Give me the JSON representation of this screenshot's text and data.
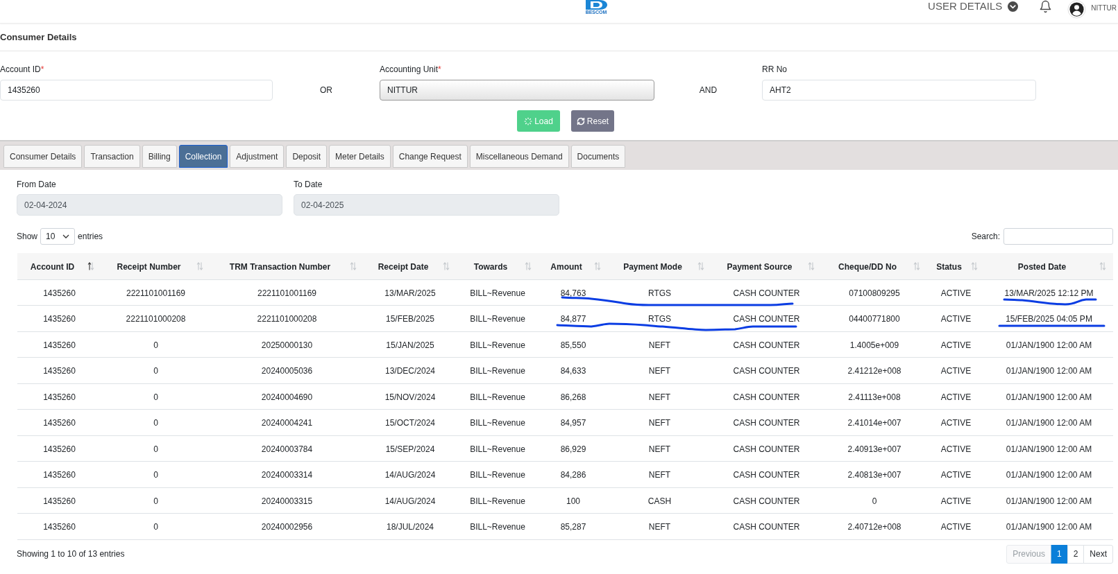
{
  "header": {
    "logo_text": "BESCOM",
    "user_menu": "USER DETAILS",
    "user_name": "NITTUR"
  },
  "section_title": "Consumer Details",
  "search_form": {
    "fields": [
      {
        "label": "Account ID",
        "required_mark": "*",
        "kind": "input",
        "value": "1435260"
      },
      {
        "label": "Accounting Unit",
        "required_mark": "*",
        "kind": "select",
        "value": "NITTUR"
      },
      {
        "label": "RR No",
        "kind": "input",
        "value": "AHT2"
      }
    ],
    "connectors": [
      "OR",
      "AND"
    ]
  },
  "buttons": [
    {
      "label": "Load",
      "kind": "load"
    },
    {
      "label": "Reset",
      "kind": "reset"
    }
  ],
  "tabs": [
    {
      "label": "Consumer Details",
      "selected": false
    },
    {
      "label": "Transaction",
      "selected": false
    },
    {
      "label": "Billing",
      "selected": false
    },
    {
      "label": "Collection",
      "selected": true
    },
    {
      "label": "Adjustment",
      "selected": false
    },
    {
      "label": "Deposit",
      "selected": false
    },
    {
      "label": "Meter Details",
      "selected": false
    },
    {
      "label": "Change Request",
      "selected": false
    },
    {
      "label": "Miscellaneous Demand",
      "selected": false
    },
    {
      "label": "Documents",
      "selected": false
    }
  ],
  "date_filters": [
    {
      "label": "From Date",
      "value": "02-04-2024",
      "disabled": true
    },
    {
      "label": "To Date",
      "value": "02-04-2025",
      "disabled": true
    }
  ],
  "table_controls": {
    "show_label": "Show",
    "page_size": "10",
    "entries_label": "entries",
    "search_label": "Search:"
  },
  "table": {
    "columns": [
      {
        "label": "Account ID",
        "sorted": true
      },
      {
        "label": "Receipt Number",
        "sorted": false
      },
      {
        "label": "TRM Transaction Number",
        "sorted": false
      },
      {
        "label": "Receipt Date",
        "sorted": false
      },
      {
        "label": "Towards",
        "sorted": false
      },
      {
        "label": "Amount",
        "sorted": false
      },
      {
        "label": "Payment Mode",
        "sorted": false
      },
      {
        "label": "Payment Source",
        "sorted": false
      },
      {
        "label": "Cheque/DD No",
        "sorted": false
      },
      {
        "label": "Status",
        "sorted": false
      },
      {
        "label": "Posted Date",
        "sorted": false
      }
    ],
    "rows": [
      [
        "1435260",
        "2221101001169",
        "2221101001169",
        "13/MAR/2025",
        "BILL~Revenue",
        "84,763",
        "RTGS",
        "CASH COUNTER",
        "07100809295",
        "ACTIVE",
        "13/MAR/2025 12:12 PM"
      ],
      [
        "1435260",
        "2221101000208",
        "2221101000208",
        "15/FEB/2025",
        "BILL~Revenue",
        "84,877",
        "RTGS",
        "CASH COUNTER",
        "04400771800",
        "ACTIVE",
        "15/FEB/2025 04:05 PM"
      ],
      [
        "1435260",
        "0",
        "20250000130",
        "15/JAN/2025",
        "BILL~Revenue",
        "85,550",
        "NEFT",
        "CASH COUNTER",
        "1.4005e+009",
        "ACTIVE",
        "01/JAN/1900 12:00 AM"
      ],
      [
        "1435260",
        "0",
        "20240005036",
        "13/DEC/2024",
        "BILL~Revenue",
        "84,633",
        "NEFT",
        "CASH COUNTER",
        "2.41212e+008",
        "ACTIVE",
        "01/JAN/1900 12:00 AM"
      ],
      [
        "1435260",
        "0",
        "20240004690",
        "15/NOV/2024",
        "BILL~Revenue",
        "86,268",
        "NEFT",
        "CASH COUNTER",
        "2.41113e+008",
        "ACTIVE",
        "01/JAN/1900 12:00 AM"
      ],
      [
        "1435260",
        "0",
        "20240004241",
        "15/OCT/2024",
        "BILL~Revenue",
        "84,957",
        "NEFT",
        "CASH COUNTER",
        "2.41014e+007",
        "ACTIVE",
        "01/JAN/1900 12:00 AM"
      ],
      [
        "1435260",
        "0",
        "20240003784",
        "15/SEP/2024",
        "BILL~Revenue",
        "86,929",
        "NEFT",
        "CASH COUNTER",
        "2.40913e+007",
        "ACTIVE",
        "01/JAN/1900 12:00 AM"
      ],
      [
        "1435260",
        "0",
        "20240003314",
        "14/AUG/2024",
        "BILL~Revenue",
        "84,286",
        "NEFT",
        "CASH COUNTER",
        "2.40813e+007",
        "ACTIVE",
        "01/JAN/1900 12:00 AM"
      ],
      [
        "1435260",
        "0",
        "20240003315",
        "14/AUG/2024",
        "BILL~Revenue",
        "100",
        "CASH",
        "CASH COUNTER",
        "0",
        "ACTIVE",
        "01/JAN/1900 12:00 AM"
      ],
      [
        "1435260",
        "0",
        "20240002956",
        "18/JUL/2024",
        "BILL~Revenue",
        "85,287",
        "NEFT",
        "CASH COUNTER",
        "2.40712e+008",
        "ACTIVE",
        "01/JAN/1900 12:00 AM"
      ]
    ]
  },
  "footer": {
    "info": "Showing 1 to 10 of 13 entries",
    "pagination": [
      {
        "label": "Previous",
        "selected": false,
        "disabled": true
      },
      {
        "label": "1",
        "selected": true,
        "disabled": false
      },
      {
        "label": "2",
        "selected": false,
        "disabled": false
      },
      {
        "label": "Next",
        "selected": false,
        "disabled": false
      }
    ]
  }
}
